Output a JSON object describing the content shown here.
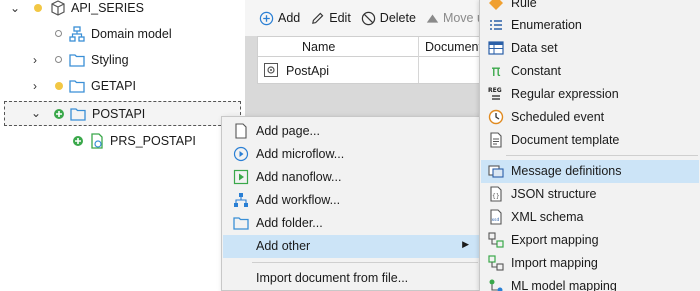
{
  "tree": {
    "items": [
      {
        "label": "API_SERIES"
      },
      {
        "label": "Domain model"
      },
      {
        "label": "Styling"
      },
      {
        "label": "GETAPI"
      },
      {
        "label": "POSTAPI"
      },
      {
        "label": "PRS_POSTAPI"
      }
    ]
  },
  "toolbar": {
    "add_label": "Add",
    "edit_label": "Edit",
    "delete_label": "Delete",
    "move_up_label": "Move up"
  },
  "grid": {
    "columns": [
      "Name",
      "Documenta"
    ],
    "rows": [
      {
        "name": "PostApi"
      }
    ]
  },
  "context_menu": {
    "items": [
      {
        "label": "Add page..."
      },
      {
        "label": "Add microflow..."
      },
      {
        "label": "Add nanoflow..."
      },
      {
        "label": "Add workflow..."
      },
      {
        "label": "Add folder..."
      },
      {
        "label": "Add other"
      },
      {
        "label": "Import document from file..."
      }
    ]
  },
  "submenu": {
    "items": [
      {
        "label": "Rule",
        "icon": "rule-icon"
      },
      {
        "label": "Enumeration",
        "icon": "list-icon"
      },
      {
        "label": "Data set",
        "icon": "dataset-icon"
      },
      {
        "label": "Constant",
        "icon": "pi-icon"
      },
      {
        "label": "Regular expression",
        "icon": "regex-icon"
      },
      {
        "label": "Scheduled event",
        "icon": "clock-icon"
      },
      {
        "label": "Document template",
        "icon": "template-icon"
      },
      {
        "label": "Message definitions",
        "icon": "message-icon"
      },
      {
        "label": "JSON structure",
        "icon": "json-icon"
      },
      {
        "label": "XML schema",
        "icon": "xml-icon"
      },
      {
        "label": "Export mapping",
        "icon": "export-mapping-icon"
      },
      {
        "label": "Import mapping",
        "icon": "import-mapping-icon"
      },
      {
        "label": "ML model mapping",
        "icon": "ml-mapping-icon"
      }
    ]
  },
  "colors": {
    "highlight": "#cce4f7",
    "folder": "#3a8fd6",
    "module_dot": "#f2c744",
    "new_dot": "#3aa84a"
  }
}
